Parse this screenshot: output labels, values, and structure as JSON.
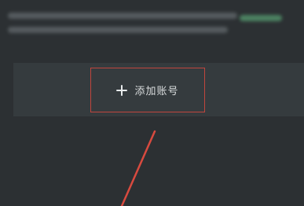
{
  "add_account": {
    "label": "添加账号",
    "icon": "plus-icon"
  },
  "notice": {
    "blurred": true
  },
  "colors": {
    "background": "#2c3033",
    "panel": "#353b3e",
    "highlight": "#c0453d",
    "link": "#4f8a66"
  }
}
